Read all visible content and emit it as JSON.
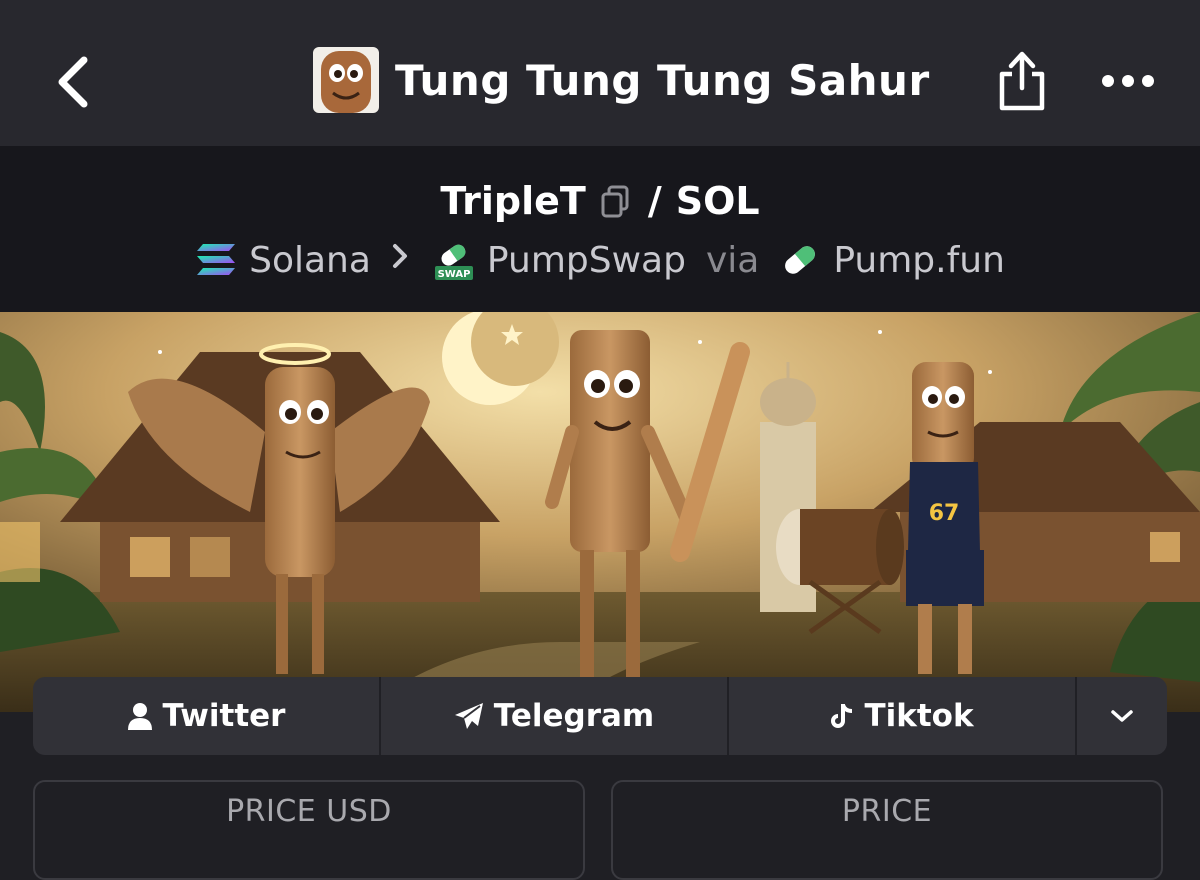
{
  "header": {
    "title": "Tung Tung Tung Sahur",
    "back_icon": "chevron-left-icon",
    "share_icon": "share-icon",
    "more_icon": "more-dots-icon"
  },
  "pair": {
    "base": "TripleT",
    "separator": "/",
    "quote": "SOL",
    "copy_icon": "copy-icon"
  },
  "route": {
    "chain": "Solana",
    "dex": "PumpSwap",
    "dex_badge": "SWAP",
    "via": "via",
    "launchpad": "Pump.fun"
  },
  "socials": [
    {
      "label": "Twitter",
      "icon": "user-icon"
    },
    {
      "label": "Telegram",
      "icon": "telegram-icon"
    },
    {
      "label": "Tiktok",
      "icon": "tiktok-icon"
    }
  ],
  "socials_more_icon": "chevron-down-icon",
  "stats": {
    "price_usd_label": "PRICE USD",
    "price_label": "PRICE"
  },
  "colors": {
    "topbar": "#28282e",
    "pair_bar": "#17171c",
    "page_bg": "#1f1f24",
    "social_bar": "#313137",
    "pump_green": "#4fbf78"
  }
}
